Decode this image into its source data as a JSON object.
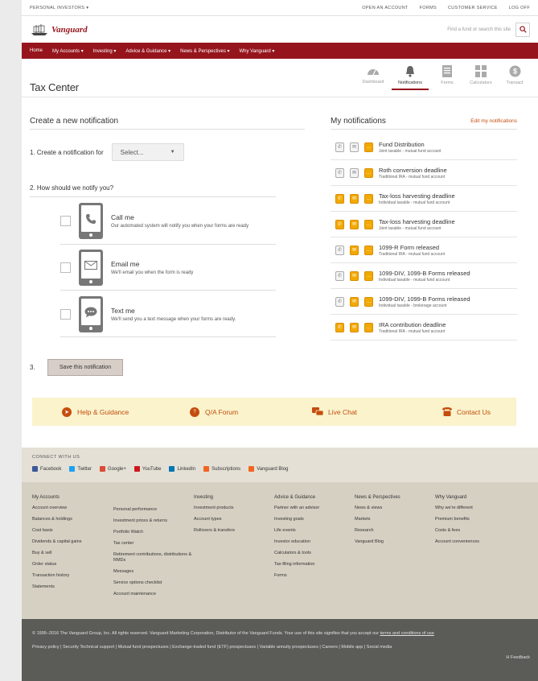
{
  "util_bar": {
    "left": "PERSONAL INVESTORS ▾",
    "links": [
      "OPEN AN ACCOUNT",
      "FORMS",
      "CUSTOMER SERVICE",
      "LOG OFF"
    ]
  },
  "brand": {
    "logo_text": "Vanguard",
    "search_placeholder": "Find a fund or search this site"
  },
  "nav": {
    "items": [
      "Home",
      "My Accounts ▾",
      "Investing ▾",
      "Advice & Guidance ▾",
      "News & Perspectives ▾",
      "Why Vanguard ▾"
    ]
  },
  "tax_center": {
    "title": "Tax Center",
    "tabs": [
      "Dashboard",
      "Notifications",
      "Forms",
      "Calculators",
      "Transact"
    ],
    "active_tab": "Notifications"
  },
  "create": {
    "heading": "Create a new notification",
    "step1_label": "1.  Create a notification for",
    "select_value": "Select...",
    "step2_label": "2.  How should we notify you?",
    "options": [
      {
        "title": "Call me",
        "desc": "Our automated system will notify you when your forms are ready"
      },
      {
        "title": "Email me",
        "desc": "We'll email you when the form is ready"
      },
      {
        "title": "Text me",
        "desc": "We'll send you a text message when your forms are ready."
      }
    ],
    "step3_label": "3.",
    "save_label": "Save this notification"
  },
  "my_notifications": {
    "heading": "My notifications",
    "edit_label": "Edit my notifications",
    "items": [
      {
        "title": "Fund Distribution",
        "sub": "Joint taxable - mutual fund account",
        "active": [
          false,
          false,
          true
        ]
      },
      {
        "title": "Roth conversion deadline",
        "sub": "Traditional IRA - mutual fund account",
        "active": [
          false,
          false,
          true
        ]
      },
      {
        "title": "Tax-loss harvesting deadline",
        "sub": "Individual taxable - mutual fund account",
        "active": [
          true,
          true,
          true
        ]
      },
      {
        "title": "Tax-loss harvesting deadline",
        "sub": "Joint taxable - mutual fund account",
        "active": [
          true,
          true,
          true
        ]
      },
      {
        "title": "1099-R Form released",
        "sub": "Traditional IRA - mutual fund account",
        "active": [
          false,
          true,
          true
        ]
      },
      {
        "title": "1099-DIV, 1099-B Forms released",
        "sub": "Individual taxable - mutual fund account",
        "active": [
          false,
          true,
          true
        ]
      },
      {
        "title": "1099-DIV, 1099-B Forms released",
        "sub": "Individual taxable - brokerage account",
        "active": [
          false,
          true,
          true
        ]
      },
      {
        "title": "IRA contribution deadline",
        "sub": "Traditional IRA - mutual fund account",
        "active": [
          true,
          true,
          true
        ]
      }
    ]
  },
  "help_bar": {
    "items": [
      "Help & Guidance",
      "Q/A Forum",
      "Live Chat",
      "Contact Us"
    ]
  },
  "connect": {
    "label": "CONNECT WITH US",
    "social": [
      "Facebook",
      "Twitter",
      "Google+",
      "YouTube",
      "LinkedIn",
      "Subscriptions",
      "Vanguard Blog"
    ]
  },
  "footer_links": {
    "col1_title": "My Accounts",
    "col1": [
      "Account overview",
      "Balances & holdings",
      "Cost basis",
      "Dividends & capital gains",
      "Buy & sell",
      "Order status",
      "Transaction history",
      "Statements"
    ],
    "col2": [
      "Personal performance",
      "Investment prices & returns",
      "Portfolio Watch",
      "Tax center",
      "Retirement contributions, distributions & RMDs",
      "Messages",
      "Service options checklist",
      "Account maintenance"
    ],
    "col3_title": "Investing",
    "col3": [
      "Investment products",
      "Account types",
      "Rollovers & transfers"
    ],
    "col4_title": "Advice & Guidance",
    "col4": [
      "Partner with an advisor",
      "Investing goals",
      "Life events",
      "Investor education",
      "Calculators & tools",
      "Tax-filing information",
      "Forms"
    ],
    "col5_title": "News & Perspectives",
    "col5": [
      "News & views",
      "Markets",
      "Research",
      "Vanguard Blog"
    ],
    "col6_title": "Why Vanguard",
    "col6": [
      "Why we're different",
      "Premium benefits",
      "Costs & fees",
      "Account conveniences"
    ]
  },
  "legal": {
    "copyright": "© 1995–2016 The Vanguard Group, Inc. All rights reserved. Vanguard Marketing Corporation, Distributor of the Vanguard Funds. Your use of this site signifies that you accept our ",
    "terms_link": "terms and conditions of use",
    "links_line": "Privacy policy  |  Security Technical support  |  Mutual fund prospectuses  |  Exchange-traded fund (ETF) prospectuses  |  Variable annuity prospectuses  |  Careers  |  Mobile app  |  Social media",
    "feedback": "H Feedback"
  },
  "colors": {
    "brand_red": "#96151d",
    "accent_orange": "#c54d0e",
    "notify_yellow": "#f2a900"
  }
}
